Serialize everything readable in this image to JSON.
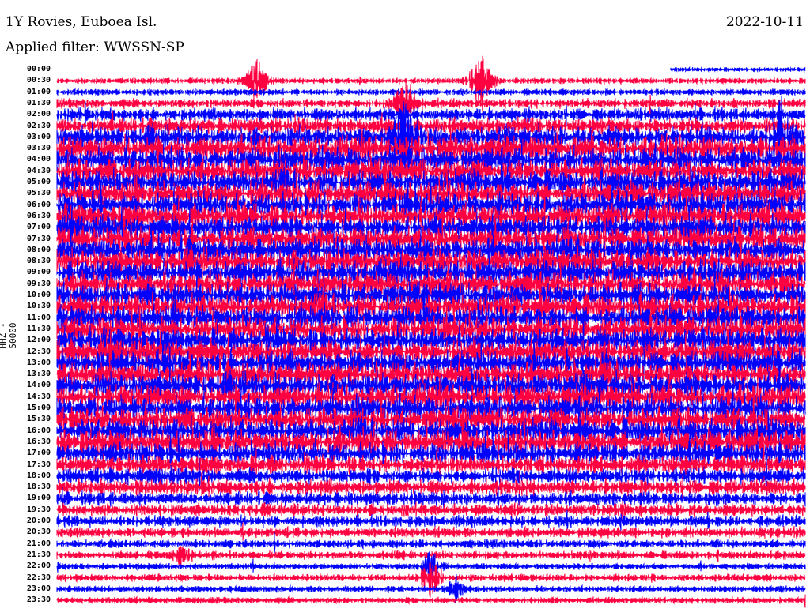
{
  "header": {
    "station": "1Y Rovies, Euboea Isl.",
    "filter": "Applied filter: WWSSN-SP",
    "date": "2022-10-11"
  },
  "chart_data": {
    "type": "line",
    "title": "1Y Rovies, Euboea Isl.",
    "ylabel": "HHZ - 50000",
    "xlabel": "",
    "colors": {
      "odd": "#0000ff",
      "even": "#ff0040"
    },
    "row_minutes": 30,
    "rows": [
      "00:00",
      "00:30",
      "01:00",
      "01:30",
      "02:00",
      "02:30",
      "03:00",
      "03:30",
      "04:00",
      "04:30",
      "05:00",
      "05:30",
      "06:00",
      "06:30",
      "07:00",
      "07:30",
      "08:00",
      "08:30",
      "09:00",
      "09:30",
      "10:00",
      "10:30",
      "11:00",
      "11:30",
      "12:00",
      "12:30",
      "13:00",
      "13:30",
      "14:00",
      "14:30",
      "15:00",
      "15:30",
      "16:00",
      "16:30",
      "17:00",
      "17:30",
      "18:00",
      "18:30",
      "19:00",
      "19:30",
      "20:00",
      "20:30",
      "21:00",
      "21:30",
      "22:00",
      "22:30",
      "23:00",
      "23:30"
    ],
    "relative_amplitude": [
      0.05,
      0.12,
      0.15,
      0.3,
      0.5,
      0.6,
      0.85,
      1,
      1,
      1,
      1,
      1,
      1,
      1,
      1,
      1,
      1,
      1,
      1,
      1,
      1,
      1,
      1,
      1,
      1,
      1,
      1,
      1,
      1,
      1,
      1,
      1,
      1,
      1,
      0.85,
      0.7,
      0.6,
      0.6,
      0.5,
      0.45,
      0.4,
      0.35,
      0.25,
      0.25,
      0.15,
      0.2,
      0.15,
      0.15
    ],
    "first_row_start_fraction": 0.82,
    "events": [
      {
        "row": 1,
        "minute": 17,
        "amp": 8
      },
      {
        "row": 1,
        "minute": 8,
        "amp": 6
      },
      {
        "row": 3,
        "minute": 14,
        "amp": 7
      },
      {
        "row": 6,
        "minute": 14,
        "amp": 9
      },
      {
        "row": 6,
        "minute": 29,
        "amp": 8
      },
      {
        "row": 44,
        "minute": 15,
        "amp": 4
      },
      {
        "row": 45,
        "minute": 15,
        "amp": 5
      },
      {
        "row": 46,
        "minute": 16,
        "amp": 3
      },
      {
        "row": 43,
        "minute": 5,
        "amp": 2
      }
    ]
  }
}
